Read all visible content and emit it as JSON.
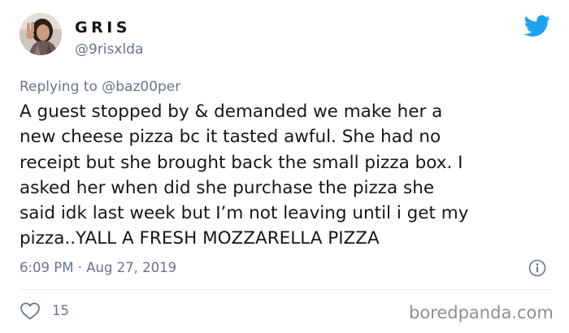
{
  "author": {
    "display_name": "GRIS",
    "handle": "@9risxlda",
    "avatar_icon": "user-photo-avatar"
  },
  "brand": {
    "logo_icon": "twitter-bird-icon",
    "color": "#1da1f2"
  },
  "reply": {
    "prefix": "Replying to ",
    "mention": "@baz00per"
  },
  "tweet": {
    "lines": [
      "A guest stopped by & demanded we make her a",
      "new cheese pizza bc it tasted awful. She had no",
      "receipt but she brought back the small pizza box. I",
      "asked her when did she purchase the pizza she",
      "said idk last week but I’m not leaving until i get my",
      "pizza..YALL A FRESH MOZZARELLA PIZZA"
    ],
    "timestamp": "6:09 PM · Aug 27, 2019"
  },
  "actions": {
    "like_icon": "heart-icon",
    "like_count": "15",
    "info_icon": "info-icon"
  },
  "watermark": {
    "text": "boredpanda.com"
  },
  "colors": {
    "text_primary": "#14171a",
    "text_secondary": "#657786",
    "divider": "#e6ecf0",
    "watermark": "#8a8f94"
  }
}
